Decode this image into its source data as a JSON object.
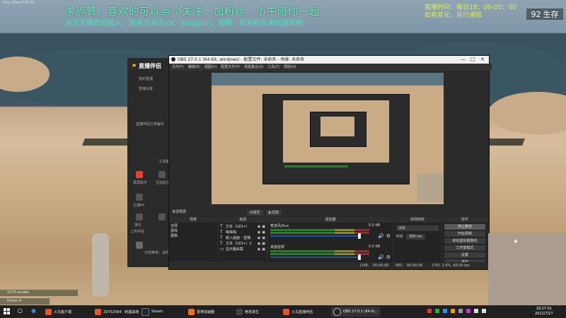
{
  "overlay": {
    "title": "求点赞，喜欢的可以点个关注，加粉丝，小牛陪你一起",
    "subtitle": "关注主播欢迎加入，加关注关注VX：Jiangjian，加群，欢迎粉丝来玩游戏吧",
    "right_line1": "直播时间：每日18：00-00：00",
    "right_line2": "如有变化，另行通知",
    "hud_number": "92",
    "hud_label": "生存",
    "top_left_info": "Ping 38ms  FPS 60"
  },
  "livecompanion": {
    "brand": "直播伴侣",
    "menu1": "我的直播",
    "menu2": "直播设置",
    "hint": "直播伴侣已准备好",
    "tools_label": "工具箱",
    "btn_record": "录屏助手",
    "btn_effects": "互动玩法",
    "btn_pk": "主播PK",
    "btn_rank": "排行",
    "btn_upload": "上传作品",
    "notice": "为您推荐，请先登录"
  },
  "obs": {
    "title": "OBS 27.0.1 (64-bit, windows) - 配置文件: 未命名 - 场景: 未命名",
    "menu": [
      "文件(F)",
      "编辑(E)",
      "视图(V)",
      "配置文件(P)",
      "场景集合(S)",
      "工具(T)",
      "帮助(H)"
    ],
    "source_label": "未选择源",
    "props_button": "属性",
    "filters_button": "滤镜",
    "docks": {
      "scenes": "场景",
      "sources": "来源",
      "mixer": "混音器",
      "transitions": "转场特效",
      "controls": "控件"
    },
    "scenes": [
      "全屏",
      "游戏",
      "摄像"
    ],
    "sources": [
      "文本（GDI+）",
      "嗡嗡嗡",
      "嵌入画面 - 直播",
      "文本（GDI+）2",
      "显示器采集"
    ],
    "mixer": [
      {
        "name": "麦克风/Aux",
        "db": "0.0 dB"
      },
      {
        "name": "桌面音频",
        "db": "0.0 dB"
      }
    ],
    "transition": {
      "type": "淡出",
      "duration_label": "时长",
      "duration": "300 ms"
    },
    "controls": [
      "停止推流",
      "开始录制",
      "启动虚拟摄像机",
      "工作室模式",
      "设置",
      "退出"
    ],
    "status": {
      "live_label": "LIVE:",
      "live_time": "00:00:00",
      "rec_label": "REC:",
      "rec_time": "00:00:00",
      "cpu": "CPU: 2.0%, 60.00 fps"
    }
  },
  "game_chat": {
    "line1": "1075-smoke",
    "line2": "Dnnnr 4"
  },
  "taskbar": {
    "search_icon": "search-icon",
    "apps": [
      {
        "label": "火鸟客户端",
        "color": "#e6532c"
      },
      {
        "label": "29752584 · 刺激战场",
        "color": "#e6532c"
      },
      {
        "label": "Steam",
        "color": "#1b2838"
      },
      {
        "label": "雷神加速器",
        "color": "#f07020"
      },
      {
        "label": "绝地求生",
        "color": "#444444"
      },
      {
        "label": "火鸟直播伴侣",
        "color": "#e6532c"
      },
      {
        "label": "OBS 27.0.1 (64-bi...",
        "color": "#222222"
      }
    ],
    "time": "18:27:01",
    "date": "2021/7/27"
  }
}
